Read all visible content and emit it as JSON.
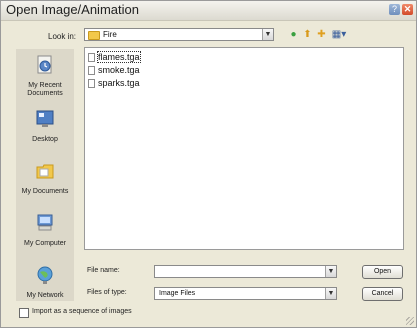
{
  "window": {
    "title": "Open Image/Animation",
    "help_glyph": "?",
    "close_glyph": "✕"
  },
  "lookin": {
    "label": "Look in:",
    "value": "Fire",
    "arrow": "▼"
  },
  "toolbar": {
    "back_glyph": "●",
    "up_glyph": "⬆",
    "new_folder_glyph": "✚",
    "views_glyph": "▦▾"
  },
  "places": [
    {
      "label": "My Recent Documents",
      "icon": "recent-documents-icon"
    },
    {
      "label": "Desktop",
      "icon": "desktop-icon"
    },
    {
      "label": "My Documents",
      "icon": "my-documents-icon"
    },
    {
      "label": "My Computer",
      "icon": "my-computer-icon"
    },
    {
      "label": "My Network",
      "icon": "my-network-icon"
    }
  ],
  "files": [
    {
      "name": "flames.tga",
      "selected": true
    },
    {
      "name": "smoke.tga",
      "selected": false
    },
    {
      "name": "sparks.tga",
      "selected": false
    }
  ],
  "filename": {
    "label": "File name:",
    "value": "",
    "arrow": "▼"
  },
  "filetype": {
    "label": "Files of type:",
    "value": "Image Files",
    "arrow": "▼"
  },
  "buttons": {
    "open": "Open",
    "cancel": "Cancel"
  },
  "sequence": {
    "label": "Import as a sequence of images",
    "checked": false
  },
  "colors": {
    "accent_folder": "#f2c84b",
    "close_button": "#d24a2a",
    "dialog_bg": "#ece9d8"
  }
}
